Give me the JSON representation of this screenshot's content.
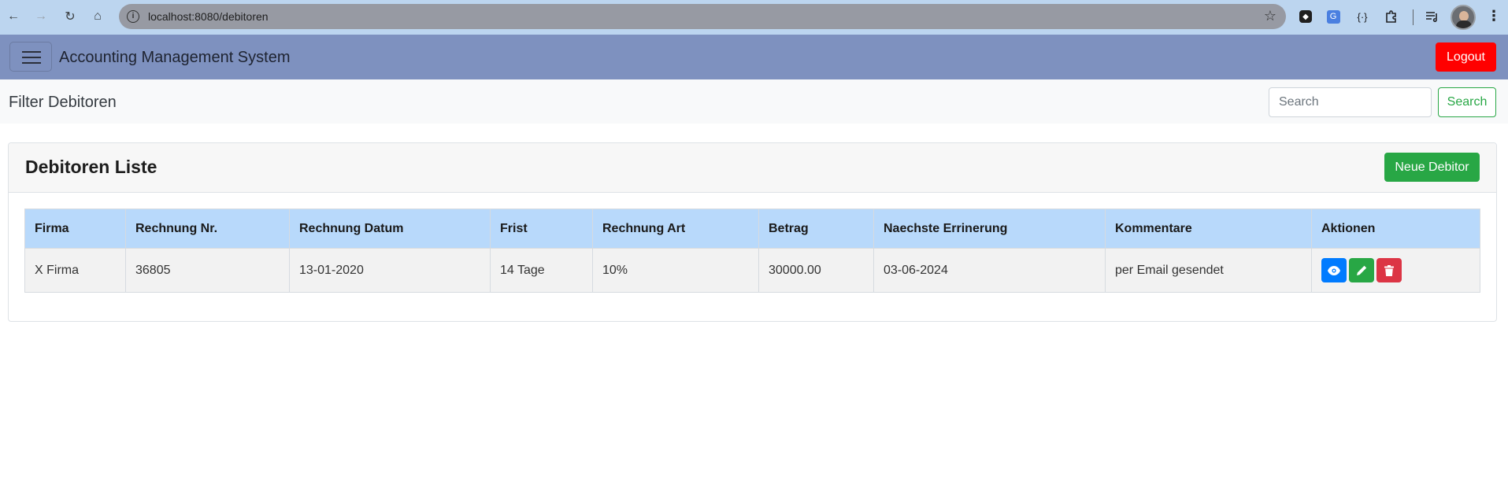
{
  "browser": {
    "url": "localhost:8080/debitoren",
    "back_icon": "←",
    "forward_icon": "→",
    "reload_icon": "↻",
    "home_icon": "⌂",
    "star_icon": "☆",
    "menu_icon": "⋮"
  },
  "app": {
    "brand": "Accounting Management System",
    "logout_label": "Logout"
  },
  "filter": {
    "title": "Filter Debitoren",
    "search_placeholder": "Search",
    "search_label": "Search"
  },
  "card": {
    "title": "Debitoren Liste",
    "new_label": "Neue Debitor"
  },
  "table": {
    "columns": [
      "Firma",
      "Rechnung Nr.",
      "Rechnung Datum",
      "Frist",
      "Rechnung Art",
      "Betrag",
      "Naechste Errinerung",
      "Kommentare",
      "Aktionen"
    ],
    "rows": [
      {
        "firma": "X Firma",
        "rechnung_nr": "36805",
        "rechnung_datum": "13-01-2020",
        "frist": "14 Tage",
        "rechnung_art": "10%",
        "betrag": "30000.00",
        "naechste_errinerung": "03-06-2024",
        "kommentare": "per Email gesendet"
      }
    ]
  },
  "colors": {
    "navbar": "#7e91bf",
    "logout": "#ff0000",
    "success": "#28a745",
    "primary": "#007bff",
    "danger": "#dc3545",
    "table_header": "#b8d9fb"
  }
}
